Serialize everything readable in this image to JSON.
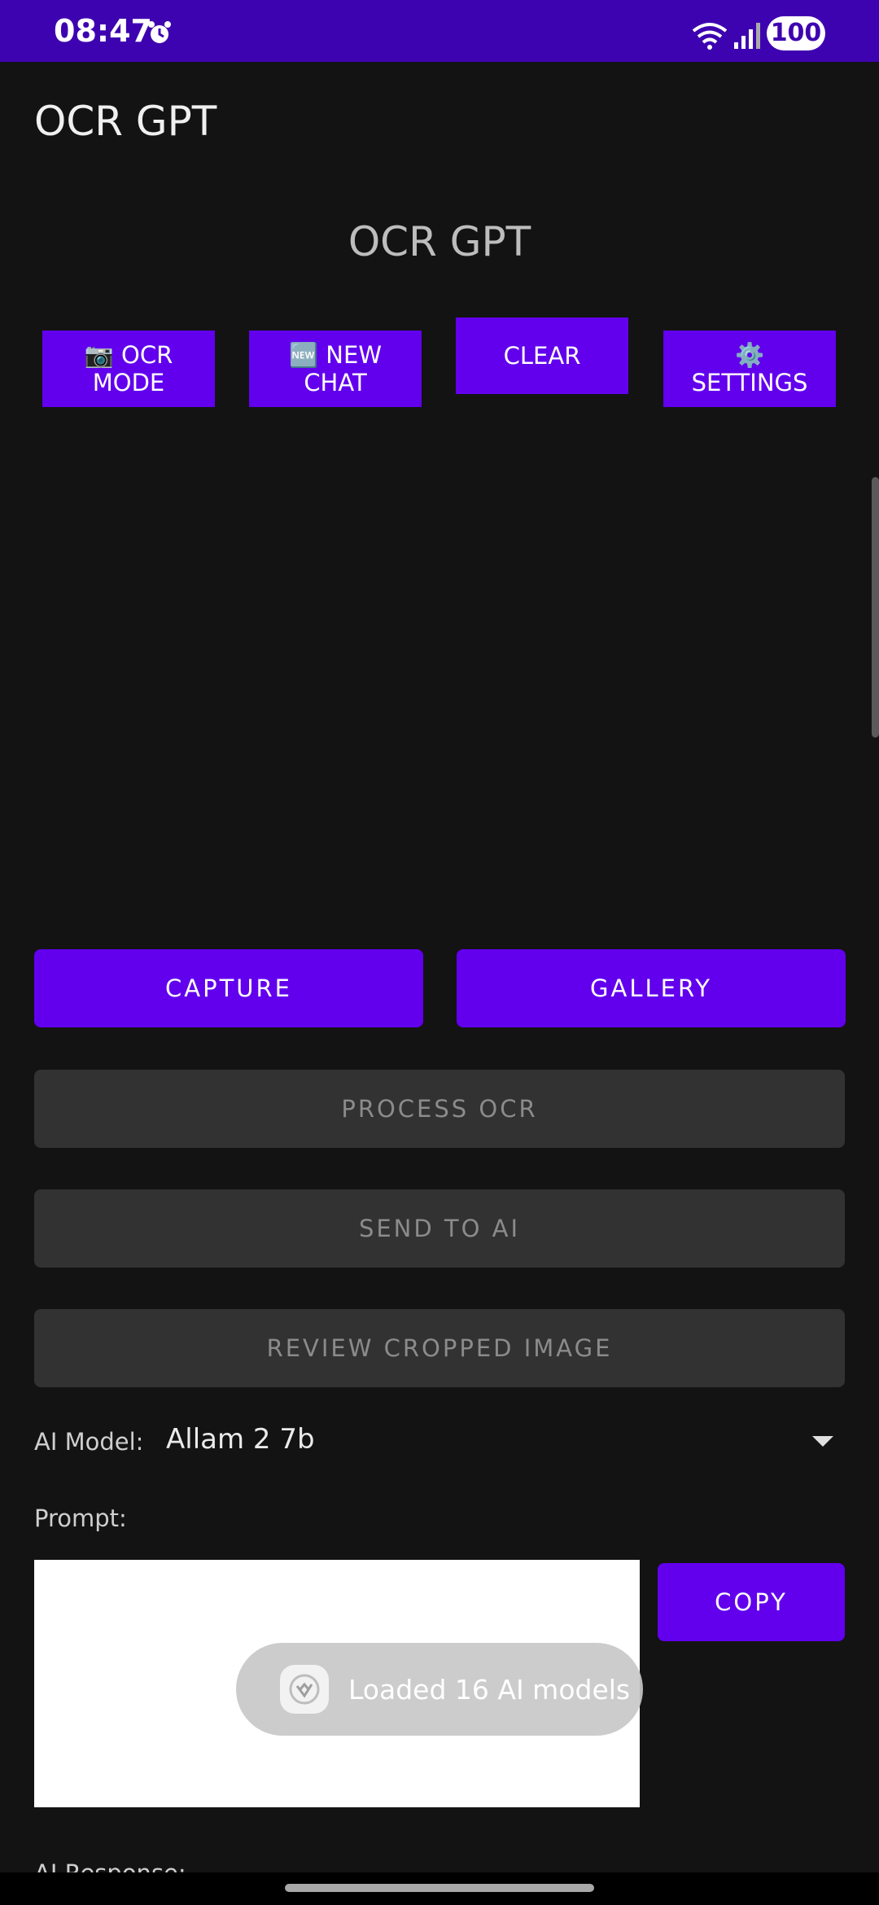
{
  "status_bar": {
    "time": "08:47",
    "battery": "100"
  },
  "app_title": "OCR GPT",
  "center_title": "OCR GPT",
  "top_buttons": {
    "ocr_mode": "📷 OCR\nMODE",
    "new_chat": "🆕 NEW\nCHAT",
    "clear": "CLEAR",
    "settings": "⚙️\nSETTINGS"
  },
  "actions": {
    "capture": "CAPTURE",
    "gallery": "GALLERY",
    "process_ocr": "PROCESS OCR",
    "send_to_ai": "SEND TO AI",
    "review": "REVIEW CROPPED IMAGE"
  },
  "ai_model": {
    "label": "AI Model:",
    "value": "Allam 2 7b"
  },
  "prompt": {
    "label": "Prompt:",
    "value": ""
  },
  "copy_label": "COPY",
  "toast": "Loaded 16 AI models",
  "ai_response_label": "AI Response:",
  "colors": {
    "accent": "#6200ee",
    "status_bar": "#3e03b0",
    "background": "#131313",
    "disabled": "#323232"
  }
}
